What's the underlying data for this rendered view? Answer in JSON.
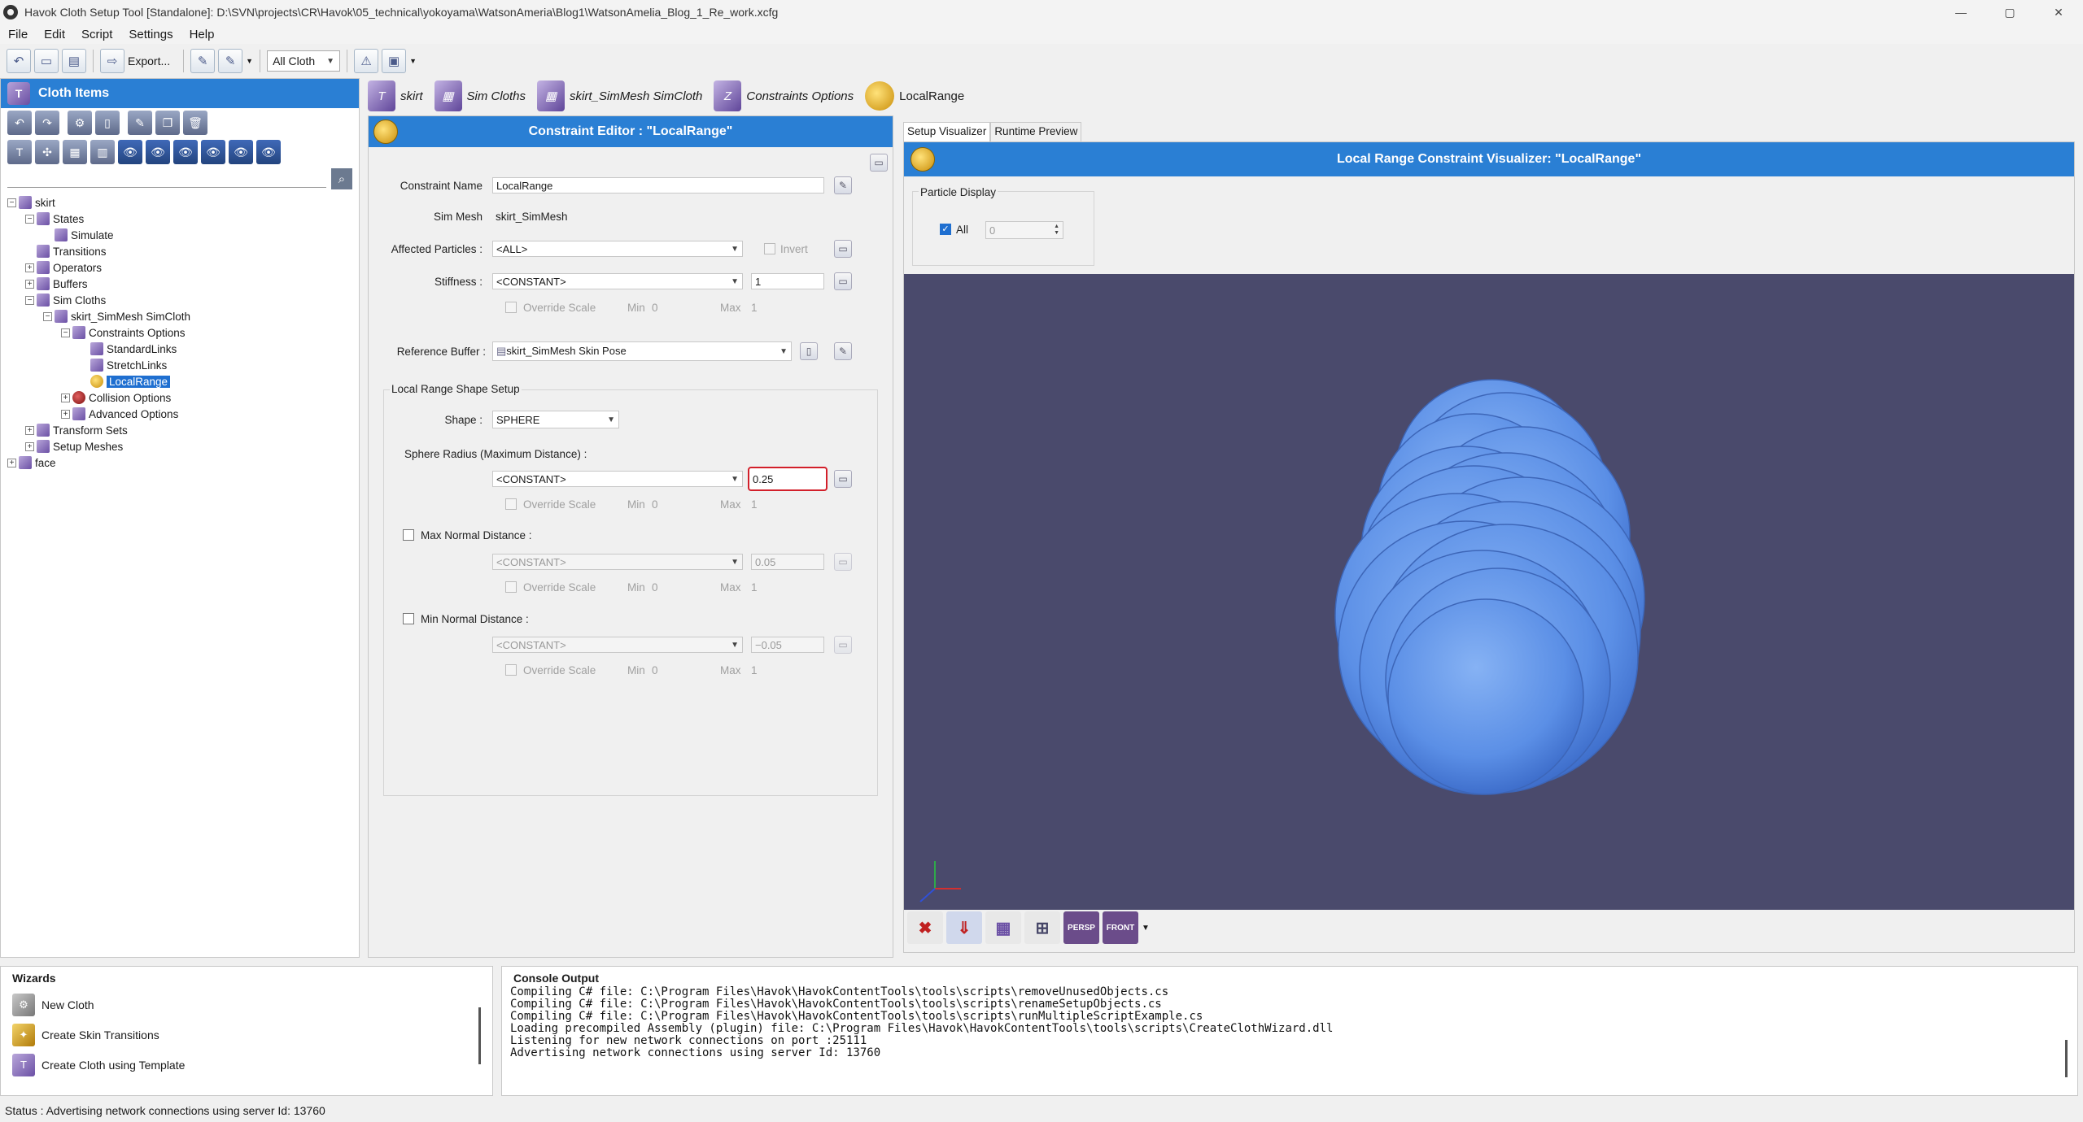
{
  "window": {
    "title": "Havok Cloth Setup Tool [Standalone]: D:\\SVN\\projects\\CR\\Havok\\05_technical\\yokoyama\\WatsonAmeria\\Blog1\\WatsonAmelia_Blog_1_Re_work.xcfg",
    "controls": [
      "—",
      "▢",
      "✕"
    ]
  },
  "menu": [
    "File",
    "Edit",
    "Script",
    "Settings",
    "Help"
  ],
  "toolbar": {
    "export_label": "Export...",
    "filter_value": "All Cloth"
  },
  "cloth_items": {
    "title": "Cloth Items",
    "tree": [
      {
        "label": "skirt",
        "depth": 0,
        "toggle": "−",
        "icon": "cloth"
      },
      {
        "label": "States",
        "depth": 1,
        "toggle": "−",
        "icon": "states"
      },
      {
        "label": "Simulate",
        "depth": 2,
        "toggle": "",
        "icon": "state"
      },
      {
        "label": "Transitions",
        "depth": 1,
        "toggle": "",
        "icon": "transitions"
      },
      {
        "label": "Operators",
        "depth": 1,
        "toggle": "+",
        "icon": "operators"
      },
      {
        "label": "Buffers",
        "depth": 1,
        "toggle": "+",
        "icon": "buffers"
      },
      {
        "label": "Sim Cloths",
        "depth": 1,
        "toggle": "−",
        "icon": "simcloths"
      },
      {
        "label": "skirt_SimMesh SimCloth",
        "depth": 2,
        "toggle": "−",
        "icon": "simcloth"
      },
      {
        "label": "Constraints Options",
        "depth": 3,
        "toggle": "−",
        "icon": "constraints"
      },
      {
        "label": "StandardLinks",
        "depth": 4,
        "toggle": "",
        "icon": "links"
      },
      {
        "label": "StretchLinks",
        "depth": 4,
        "toggle": "",
        "icon": "links"
      },
      {
        "label": "LocalRange",
        "depth": 4,
        "toggle": "",
        "icon": "localrange",
        "selected": true
      },
      {
        "label": "Collision Options",
        "depth": 3,
        "toggle": "+",
        "icon": "collision"
      },
      {
        "label": "Advanced Options",
        "depth": 3,
        "toggle": "+",
        "icon": "advanced"
      },
      {
        "label": "Transform Sets",
        "depth": 1,
        "toggle": "+",
        "icon": "transforms"
      },
      {
        "label": "Setup Meshes",
        "depth": 1,
        "toggle": "+",
        "icon": "meshes"
      },
      {
        "label": "face",
        "depth": 0,
        "toggle": "+",
        "icon": "cloth"
      }
    ]
  },
  "breadcrumb": [
    "skirt",
    "Sim Cloths",
    "skirt_SimMesh SimCloth",
    "Constraints Options",
    "LocalRange"
  ],
  "editor": {
    "title": "Constraint Editor : \"LocalRange\"",
    "constraint_name_label": "Constraint Name",
    "constraint_name_value": "LocalRange",
    "sim_mesh_label": "Sim Mesh",
    "sim_mesh_value": "skirt_SimMesh",
    "affected_label": "Affected Particles :",
    "affected_value": "<ALL>",
    "invert_label": "Invert",
    "stiffness_label": "Stiffness :",
    "stiffness_mode": "<CONSTANT>",
    "stiffness_value": "1",
    "override_scale": "Override Scale",
    "min_label": "Min",
    "max_label": "Max",
    "min_value": "0",
    "max_value": "1",
    "reference_buffer_label": "Reference Buffer :",
    "reference_buffer_value": "skirt_SimMesh Skin Pose",
    "shape_group_title": "Local Range Shape Setup",
    "shape_label": "Shape :",
    "shape_value": "SPHERE",
    "sphere_radius_label": "Sphere Radius (Maximum Distance) :",
    "sphere_radius_mode": "<CONSTANT>",
    "sphere_radius_value": "0.25",
    "max_normal_label": "Max Normal Distance :",
    "max_normal_mode": "<CONSTANT>",
    "max_normal_value": "0.05",
    "min_normal_label": "Min Normal Distance :",
    "min_normal_mode": "<CONSTANT>",
    "min_normal_value": "−0.05"
  },
  "visualizer": {
    "tabs": [
      "Setup Visualizer",
      "Runtime Preview"
    ],
    "title": "Local Range Constraint Visualizer: \"LocalRange\"",
    "particle_display_label": "Particle Display",
    "all_label": "All",
    "particle_index": "0",
    "view_buttons": [
      "PERSP",
      "FRONT"
    ],
    "viewport_bg": "#4a4a6c",
    "sphere_color": "#5b8fe6"
  },
  "wizards": {
    "title": "Wizards",
    "items": [
      "New Cloth",
      "Create Skin Transitions",
      "Create Cloth using Template"
    ]
  },
  "console": {
    "title": "Console Output",
    "lines": "Compiling C# file: C:\\Program Files\\Havok\\HavokContentTools\\tools\\scripts\\removeUnusedObjects.cs\nCompiling C# file: C:\\Program Files\\Havok\\HavokContentTools\\tools\\scripts\\renameSetupObjects.cs\nCompiling C# file: C:\\Program Files\\Havok\\HavokContentTools\\tools\\scripts\\runMultipleScriptExample.cs\nLoading precompiled Assembly (plugin) file: C:\\Program Files\\Havok\\HavokContentTools\\tools\\scripts\\CreateClothWizard.dll\nListening for new network connections on port :25111\nAdvertising network connections using server Id: 13760"
  },
  "status": "Status : Advertising network connections using server Id: 13760"
}
